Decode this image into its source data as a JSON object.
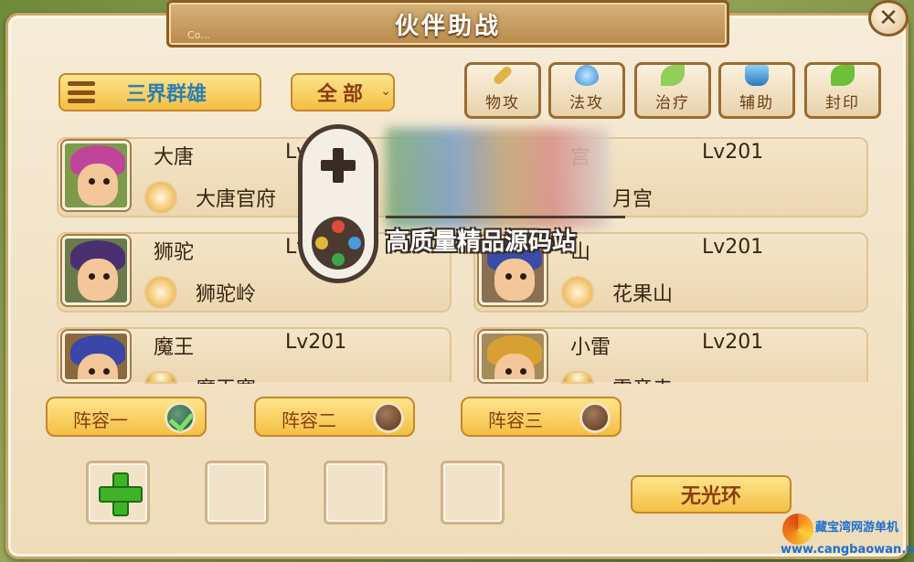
{
  "window": {
    "title": "伙伴助战",
    "banner_tag": "Co...",
    "close_glyph": "✕"
  },
  "toolbar": {
    "faction_label": "三界群雄",
    "filter_label": "全部",
    "roles": [
      {
        "label": "物攻",
        "icon": "sword-icon",
        "color": "#e2b24a"
      },
      {
        "label": "法攻",
        "icon": "gem-icon",
        "color": "#4aa8e8"
      },
      {
        "label": "治疗",
        "icon": "leaf-icon",
        "color": "#8fcf5a"
      },
      {
        "label": "辅助",
        "icon": "potion-icon",
        "color": "#3a9ad8"
      },
      {
        "label": "封印",
        "icon": "seal-leaf-icon",
        "color": "#6fbf3a"
      }
    ]
  },
  "partners": [
    {
      "name": "大唐",
      "level": "Lv201",
      "sect": "大唐官府",
      "hair": "#c0449a"
    },
    {
      "name": "宫",
      "level": "Lv201",
      "sect": "月宫",
      "hair": "#5a6ab0"
    },
    {
      "name": "狮驼",
      "level": "Lv",
      "sect": "狮驼岭",
      "hair": "#4a3070"
    },
    {
      "name": "山",
      "level": "Lv201",
      "sect": "花果山",
      "hair": "#3a4ca8"
    },
    {
      "name": "魔王",
      "level": "Lv201",
      "sect": "魔王寨",
      "hair": "#3a46a8"
    },
    {
      "name": "小雷",
      "level": "Lv201",
      "sect": "雷音寺",
      "hair": "#d8a030"
    }
  ],
  "lineups": [
    {
      "label": "阵容一",
      "selected": true
    },
    {
      "label": "阵容二",
      "selected": false
    },
    {
      "label": "阵容三",
      "selected": false
    }
  ],
  "aura_label": "无光环",
  "watermark": {
    "text": "高质量精品源码站"
  },
  "corner_logo": {
    "name": "藏宝湾网游单机",
    "url": "www.cangbaowan.net"
  }
}
